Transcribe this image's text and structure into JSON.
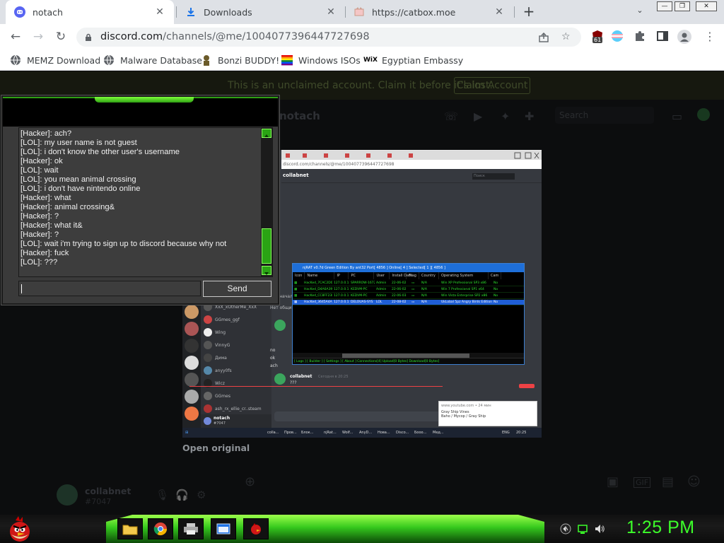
{
  "browser": {
    "tabs": [
      {
        "title": "notach",
        "close": "✕"
      },
      {
        "title": "Downloads",
        "close": "✕"
      },
      {
        "title": "https://catbox.moe",
        "close": "✕"
      }
    ],
    "new_tab": "+",
    "tab_search": "⌄",
    "window_controls": {
      "minimize": "—",
      "restore": "❐",
      "close": "✕"
    },
    "nav": {
      "back": "←",
      "forward": "→",
      "reload": "↻"
    },
    "url": {
      "host": "discord.com",
      "path": "/channels/@me/1004077396447727698"
    },
    "extension_badge": "61",
    "bookmarks": [
      {
        "label": "MEMZ Download",
        "icon": "globe-icon"
      },
      {
        "label": "Malware Database",
        "icon": "globe-icon"
      },
      {
        "label": "Bonzi BUDDY!",
        "icon": "bonzi-icon"
      },
      {
        "label": "Windows ISOs",
        "icon": "windows-icon"
      },
      {
        "label": "Egyptian Embassy",
        "icon": "wix-icon"
      }
    ],
    "wix_mark": "WiX"
  },
  "discord": {
    "banner_text": "This is an unclaimed account. Claim it before it's lost.",
    "claim_button": "Claim Account",
    "channel_name": "@notach",
    "search_placeholder": "Search",
    "open_original": "Open original",
    "user": {
      "name": "collabnet",
      "tag": "#7047"
    }
  },
  "embedded_shot": {
    "url": "discord.com/channels/@me/1004077396447727698",
    "channel": "collabnet",
    "search": "Поиск",
    "rat_title": "njRAT v0.7d Green Edition By ant32    Port[ 4856 ]    Online[ 4 ]    Selected[ 1 ][ 4856 ]",
    "rat_columns": [
      "Icon",
      "Name",
      "IP",
      "PC",
      "User",
      "Install Date",
      "Flag",
      "Country",
      "Operating System",
      "Cam"
    ],
    "rat_rows": [
      [
        "HacKed_7CAC2D06",
        "127.0.0.1",
        "SPARROW-16726",
        "Admin",
        "22-06-02",
        "N/A",
        "Win XP Professional SP3 x86",
        "No"
      ],
      [
        "HacKed_D4A6A39E",
        "127.0.0.1",
        "KEDVM-PC",
        "Admin",
        "22-06-02",
        "N/A",
        "Win 7 Professional SP1 x64",
        "No"
      ],
      [
        "HacKed_CC8FF23E",
        "127.0.0.1",
        "KEDVM-PC",
        "Admin",
        "22-06-03",
        "N/A",
        "Win Vista Enterprise SP2 x86",
        "No"
      ],
      [
        "HacKed_3645A4A8",
        "127.0.0.1",
        "DELOUAS-SYS",
        "LOL",
        "22-08-02",
        "N/A",
        "UkLobal 5pz Angry Birds Edition Ultimate SP1 x64",
        "No"
      ]
    ],
    "rat_footer": "[ Logs ]  [ Builder ]  [ Settings ]  [ About ]   Connections[4]   Upload[0 Bytes]   Download[0 Bytes]",
    "dm_names": [
      "XxX_xOtherMe_XxX",
      "GGmes_ggf",
      "Wing",
      "VinnyG",
      "Дима",
      "anyy0fs",
      "Wicz",
      "GGmes",
      "ash_rx_ellie_cr..steam"
    ],
    "chat": [
      {
        "author": "",
        "text": "Это начало..."
      },
      {
        "author": "",
        "text": "Нет общих..."
      },
      {
        "author": "",
        "text": "no"
      },
      {
        "author": "",
        "text": "ok"
      },
      {
        "author": "",
        "text": "ach"
      },
      {
        "author": "collabnet",
        "time": "Сегодня в 20:25",
        "text": "???"
      }
    ],
    "toast": {
      "site": "www.youtube.com • 24 мин",
      "title": "Gray Ship Vines",
      "body": "Baho / Mycop / Gray Ship"
    },
    "user_name": "notach",
    "user_tag": "#7047",
    "taskbar_items": [
      "colla...",
      "Пров...",
      "Блок...",
      "Блок...",
      "njRat...",
      "Wolf...",
      "AnyD...",
      "Нова...",
      "Disco...",
      "Бооо...",
      "Мед..."
    ],
    "tray_clock": "20:25",
    "tray_lang": "ENG"
  },
  "chat_client": {
    "lines": [
      "[Hacker]: ach?",
      "[LOL]: my user name is not guest",
      "[LOL]: i don't know the other user's username",
      "[Hacker]: ok",
      "[LOL]: wait",
      "[LOL]: you mean animal crossing",
      "[LOL]: i don't have nintendo online",
      "[Hacker]: what",
      "[Hacker]: animal crossing&",
      "[Hacker]: ?",
      "[Hacker]: what it&",
      "[Hacker]: ?",
      "[LOL]: wait i'm trying to sign up to discord because why not",
      "[Hacker]: fuck",
      "[LOL]: ???"
    ],
    "input_value": "",
    "send_label": "Send"
  },
  "taskbar": {
    "clock": "1:25 PM",
    "pinned": [
      "file-explorer-icon",
      "chrome-icon",
      "printer-icon",
      "browser-window-icon",
      "angry-bird-app-icon"
    ]
  },
  "colors": {
    "accent_green": "#3cff2a",
    "discord_green": "#3ba55d",
    "chrome_tabstrip": "#dee1e6"
  }
}
